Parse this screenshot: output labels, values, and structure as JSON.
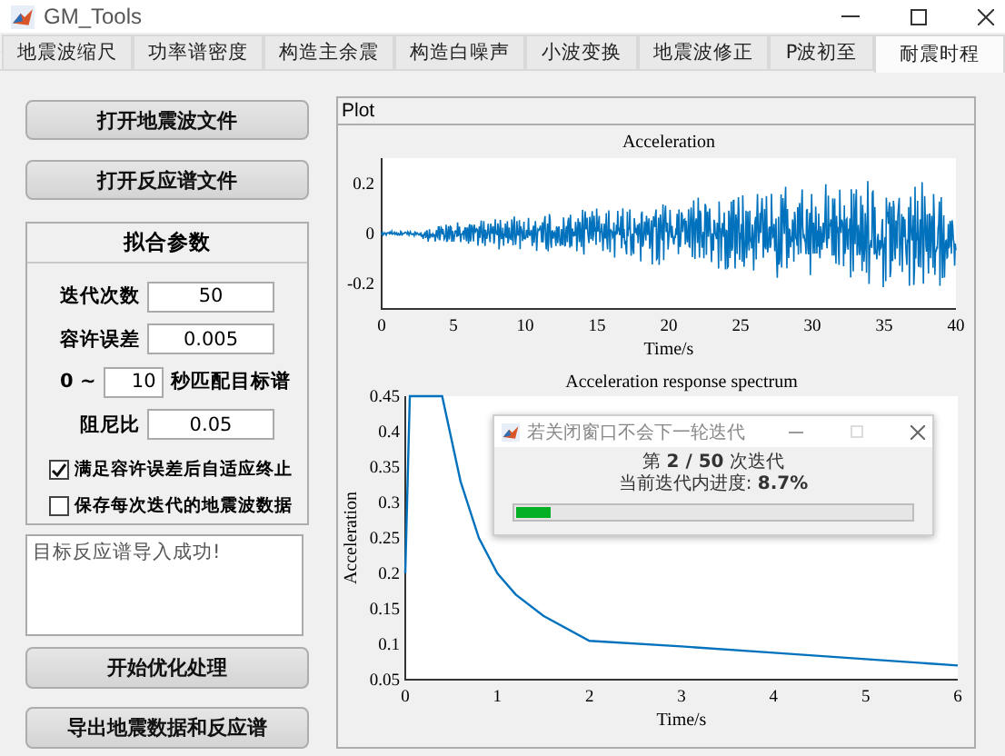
{
  "window": {
    "title": "GM_Tools"
  },
  "tabs": [
    {
      "label": "地震波缩尺",
      "selected": false
    },
    {
      "label": "功率谱密度",
      "selected": false
    },
    {
      "label": "构造主余震",
      "selected": false
    },
    {
      "label": "构造白噪声",
      "selected": false
    },
    {
      "label": "小波变换",
      "selected": false
    },
    {
      "label": "地震波修正",
      "selected": false
    },
    {
      "label": "P波初至",
      "selected": false
    },
    {
      "label": "耐震时程",
      "selected": true
    }
  ],
  "top_buttons": [
    "打开地震波文件",
    "打开反应谱文件"
  ],
  "fit_panel": {
    "title": "拟合参数",
    "iterations": {
      "label": "迭代次数",
      "value": "50"
    },
    "tolerance": {
      "label": "容许误差",
      "value": "0.005"
    },
    "match_range": {
      "prefix": "0 ~",
      "value": "10",
      "suffix": "秒匹配目标谱"
    },
    "damping": {
      "label": "阻尼比",
      "value": "0.05"
    },
    "options": [
      {
        "label": "满足容许误差后自适应终止",
        "checked": true
      },
      {
        "label": "保存每次迭代的地震波数据",
        "checked": false
      }
    ]
  },
  "message": "目标反应谱导入成功!",
  "bottom_buttons": [
    "开始优化处理",
    "导出地震数据和反应谱"
  ],
  "plot_panel": {
    "title": "Plot",
    "acceleration_plot": {
      "title": "Acceleration",
      "xlabel": "Time/s",
      "xticks": [
        "0",
        "5",
        "10",
        "15",
        "20",
        "25",
        "30",
        "35",
        "40"
      ],
      "yticks": [
        "0.2",
        "0",
        "-0.2"
      ]
    },
    "spectrum_plot": {
      "chart_data": {
        "type": "line",
        "title": "Acceleration response spectrum",
        "xlabel": "Time/s",
        "ylabel": "Acceleration",
        "x": [
          0,
          0.05,
          0.1,
          0.4,
          0.6,
          0.8,
          1,
          1.2,
          1.5,
          2,
          3,
          4,
          5,
          6
        ],
        "series": [
          {
            "color": "#0072bd",
            "values": [
              0.2,
              0.45,
              0.45,
              0.45,
              0.33,
              0.25,
              0.2,
              0.17,
              0.14,
              0.105,
              0.097,
              0.088,
              0.079,
              0.07
            ]
          }
        ],
        "xlim": [
          0,
          6
        ],
        "ylim": [
          0.05,
          0.45
        ],
        "xticks": [
          0,
          1,
          2,
          3,
          4,
          5,
          6
        ],
        "yticks": [
          0.05,
          0.1,
          0.15,
          0.2,
          0.25,
          0.3,
          0.35,
          0.4,
          0.45
        ]
      }
    }
  },
  "progress_dialog": {
    "title": "若关闭窗口不会下一轮迭代",
    "line1": "第 **2 / 50** 次迭代",
    "line2": "当前迭代内进度: **8.7%**",
    "level": 0.087
  }
}
